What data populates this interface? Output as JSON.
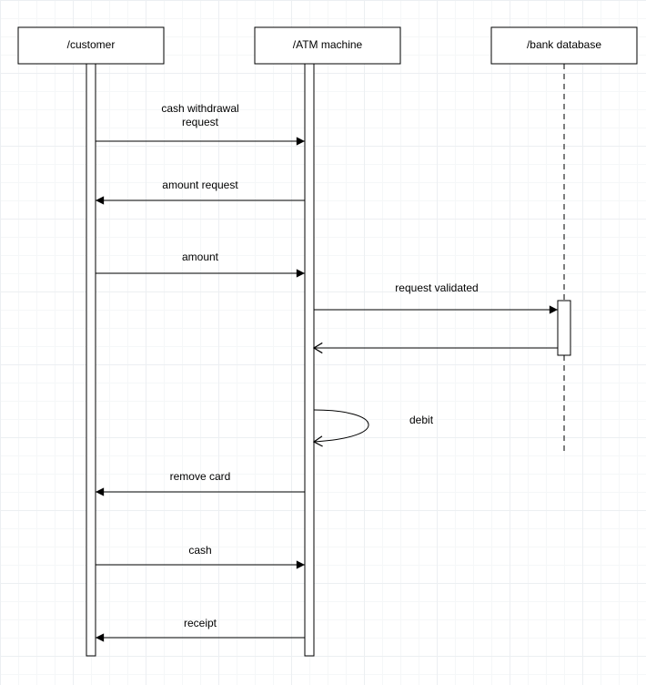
{
  "participants": {
    "customer": {
      "label": "/customer"
    },
    "atm": {
      "label": "/ATM machine"
    },
    "bank": {
      "label": "/bank database"
    }
  },
  "messages": {
    "m1": "cash withdrawal",
    "m1b": "request",
    "m2": "amount request",
    "m3": "amount",
    "m4": "request validated",
    "m5": "debit",
    "m6": "remove card",
    "m7": "cash",
    "m8": "receipt"
  },
  "chart_data": {
    "type": "table",
    "title": "UML sequence diagram: ATM cash withdrawal",
    "participants": [
      "/customer",
      "/ATM machine",
      "/bank database"
    ],
    "interactions": [
      {
        "from": "/customer",
        "to": "/ATM machine",
        "label": "cash withdrawal request",
        "kind": "sync"
      },
      {
        "from": "/ATM machine",
        "to": "/customer",
        "label": "amount request",
        "kind": "sync"
      },
      {
        "from": "/customer",
        "to": "/ATM machine",
        "label": "amount",
        "kind": "sync"
      },
      {
        "from": "/ATM machine",
        "to": "/bank database",
        "label": "request validated",
        "kind": "sync"
      },
      {
        "from": "/bank database",
        "to": "/ATM machine",
        "label": "",
        "kind": "return"
      },
      {
        "from": "/ATM machine",
        "to": "/ATM machine",
        "label": "debit",
        "kind": "self"
      },
      {
        "from": "/ATM machine",
        "to": "/customer",
        "label": "remove card",
        "kind": "sync"
      },
      {
        "from": "/customer",
        "to": "/ATM machine",
        "label": "cash",
        "kind": "sync"
      },
      {
        "from": "/ATM machine",
        "to": "/customer",
        "label": "receipt",
        "kind": "sync"
      }
    ]
  }
}
